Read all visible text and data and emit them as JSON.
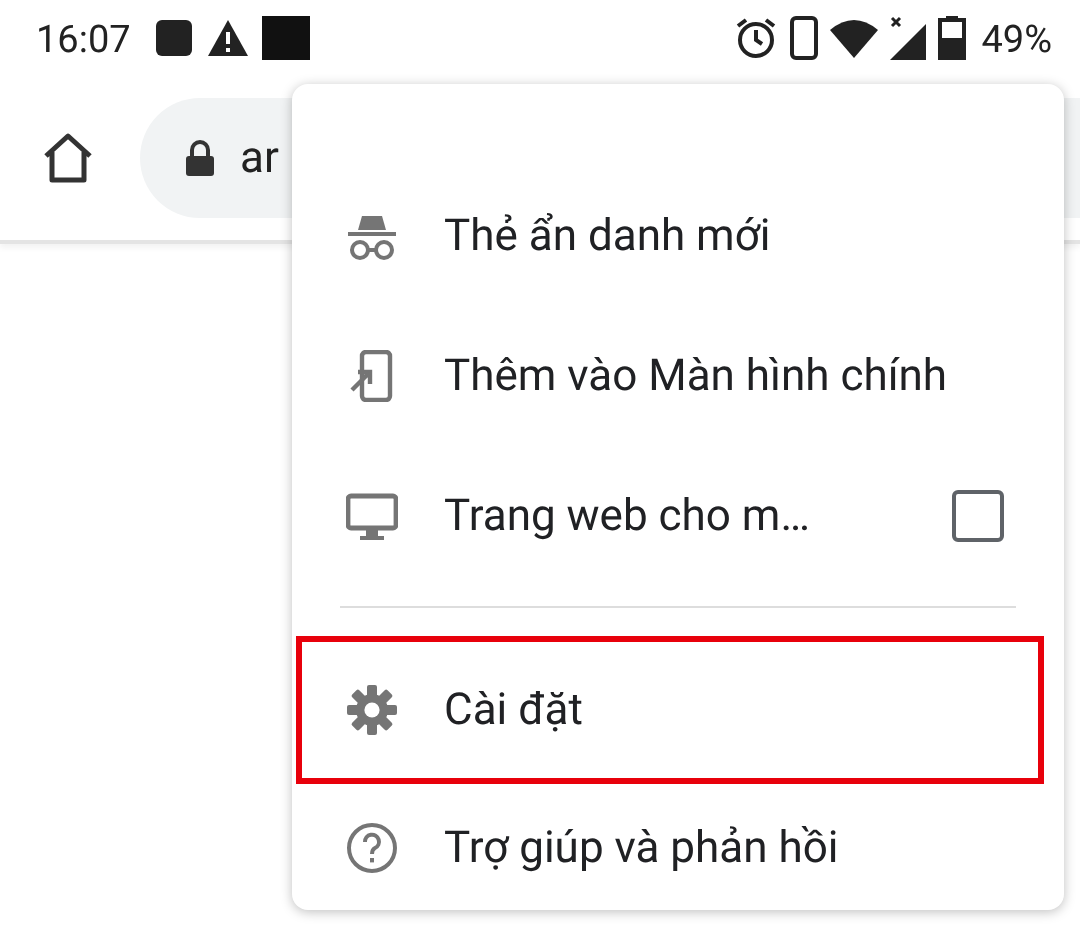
{
  "status_bar": {
    "time": "16:07",
    "battery": "49%"
  },
  "toolbar": {
    "url": "ar"
  },
  "menu": {
    "items": [
      {
        "kind": "item",
        "label": "Thẻ ẩn danh mới",
        "highlighted": false
      },
      {
        "kind": "item",
        "label": "Thêm vào Màn hình chính",
        "highlighted": false
      },
      {
        "kind": "checkbox",
        "label": "Trang web cho m…",
        "checked": false,
        "highlighted": false
      },
      {
        "kind": "divider"
      },
      {
        "kind": "item",
        "label": "Cài đặt",
        "highlighted": true
      },
      {
        "kind": "item",
        "label": "Trợ giúp và phản hồi",
        "highlighted": false
      }
    ]
  }
}
